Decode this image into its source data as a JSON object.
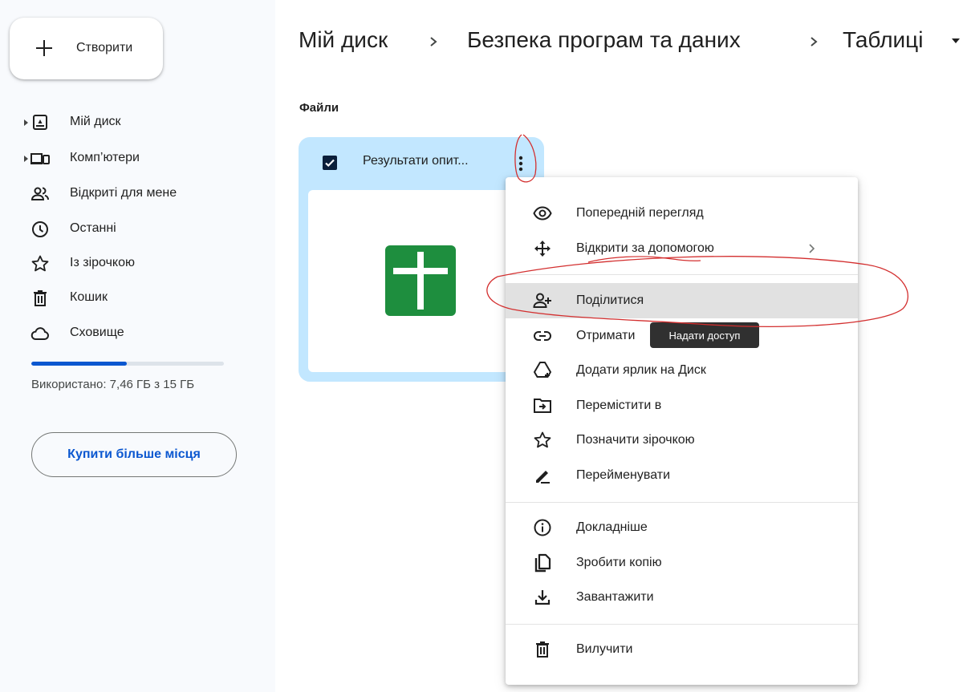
{
  "sidebar": {
    "create_label": "Створити",
    "items": [
      {
        "label": "Мій диск",
        "icon": "drive-icon",
        "expandable": true
      },
      {
        "label": "Комп’ютери",
        "icon": "computers-icon",
        "expandable": true
      },
      {
        "label": "Відкриті для мене",
        "icon": "shared-people-icon",
        "expandable": false
      },
      {
        "label": "Останні",
        "icon": "clock-icon",
        "expandable": false
      },
      {
        "label": "Із зірочкою",
        "icon": "star-icon",
        "expandable": false
      },
      {
        "label": "Кошик",
        "icon": "trash-icon",
        "expandable": false
      },
      {
        "label": "Сховище",
        "icon": "cloud-icon",
        "expandable": false
      }
    ],
    "storage_text": "Використано: 7,46 ГБ з 15 ГБ",
    "storage_fraction": 0.497,
    "buy_label": "Купити більше місця"
  },
  "breadcrumb": {
    "items": [
      "Мій диск",
      "Безпека програм та даних",
      "Таблиці"
    ]
  },
  "section_label": "Файли",
  "file": {
    "name": "Результати опит...",
    "selected": true,
    "type_icon": "google-sheets-icon"
  },
  "context_menu": {
    "items": [
      {
        "label": "Попередній перегляд",
        "icon": "eye-icon"
      },
      {
        "label": "Відкрити за допомогою",
        "icon": "open-with-icon",
        "submenu": true
      },
      {
        "label": "Поділитися",
        "icon": "person-add-icon",
        "highlighted": true
      },
      {
        "label": "Отримати",
        "icon": "link-icon"
      },
      {
        "label": "Додати ярлик на Диск",
        "icon": "add-to-drive-icon"
      },
      {
        "label": "Перемістити в",
        "icon": "move-to-folder-icon"
      },
      {
        "label": "Позначити зірочкою",
        "icon": "star-icon"
      },
      {
        "label": "Перейменувати",
        "icon": "rename-pen-icon"
      },
      {
        "label": "Докладніше",
        "icon": "info-icon"
      },
      {
        "label": "Зробити копію",
        "icon": "copy-icon"
      },
      {
        "label": "Завантажити",
        "icon": "download-icon"
      },
      {
        "label": "Вилучити",
        "icon": "trash-icon"
      }
    ]
  },
  "tooltip": "Надати доступ",
  "colors": {
    "accent": "#0b57d0",
    "card_selected": "#c2e7ff",
    "sheets_green": "#1e8e3e",
    "annotation_red": "#d32f2f",
    "sidebar_bg": "#f8fafd"
  }
}
